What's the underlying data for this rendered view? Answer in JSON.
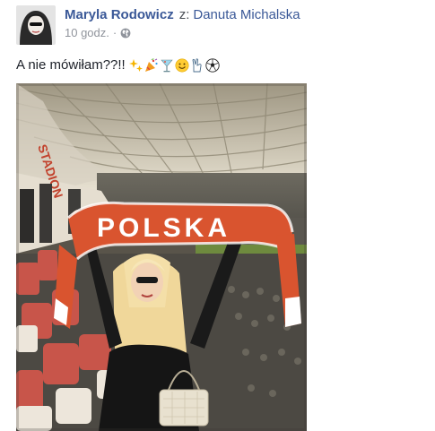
{
  "post": {
    "author": "Maryla Rodowicz",
    "separator": "z:",
    "tagged_user": "Danuta Michalska",
    "timestamp": "10 godz.",
    "dot": "·",
    "privacy_icon": "globe-icon",
    "text": "A nie mówiłam??!!",
    "emojis": [
      "sparkles-icon",
      "party-popper-icon",
      "cocktail-glass-icon",
      "smiling-face-icon",
      "victory-hand-icon",
      "soccer-ball-icon"
    ]
  },
  "photo": {
    "scarf_text": "POLSKA",
    "scarf_color": "#d9542f",
    "seats_color": "#c8554a"
  }
}
